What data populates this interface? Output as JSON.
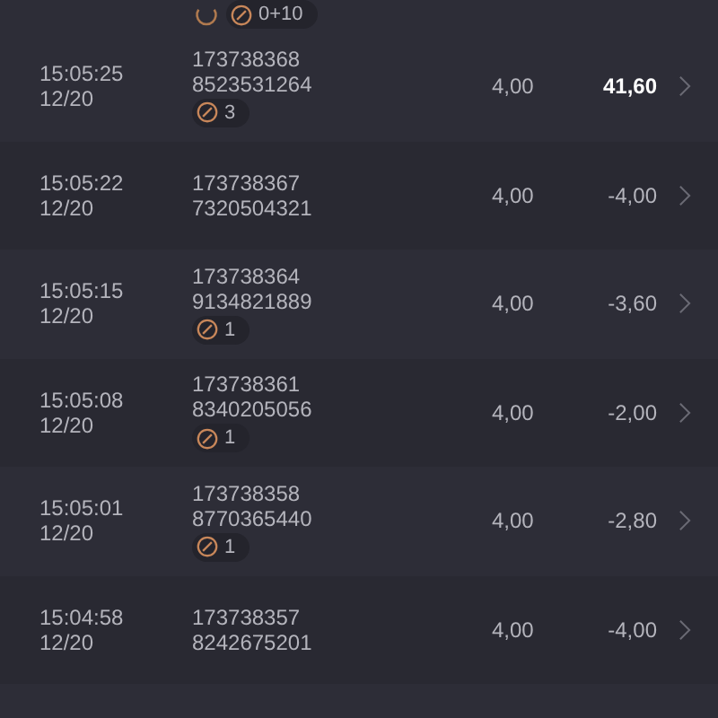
{
  "top_partial_row": {
    "badge": "0+10",
    "loading": true
  },
  "rows": [
    {
      "time": "15:05:25",
      "date": "12/20",
      "id_1": "173738368",
      "id_2": "8523531264",
      "badge": "3",
      "stake": "4,00",
      "result": "41,60",
      "win": true
    },
    {
      "time": "15:05:22",
      "date": "12/20",
      "id_1": "173738367",
      "id_2": "7320504321",
      "stake": "4,00",
      "result": "-4,00",
      "win": false
    },
    {
      "time": "15:05:15",
      "date": "12/20",
      "id_1": "173738364",
      "id_2": "9134821889",
      "badge": "1",
      "stake": "4,00",
      "result": "-3,60",
      "win": false
    },
    {
      "time": "15:05:08",
      "date": "12/20",
      "id_1": "173738361",
      "id_2": "8340205056",
      "badge": "1",
      "stake": "4,00",
      "result": "-2,00",
      "win": false
    },
    {
      "time": "15:05:01",
      "date": "12/20",
      "id_1": "173738358",
      "id_2": "8770365440",
      "badge": "1",
      "stake": "4,00",
      "result": "-2,80",
      "win": false
    },
    {
      "time": "15:04:58",
      "date": "12/20",
      "id_1": "173738357",
      "id_2": "8242675201",
      "stake": "4,00",
      "result": "-4,00",
      "win": false
    }
  ]
}
